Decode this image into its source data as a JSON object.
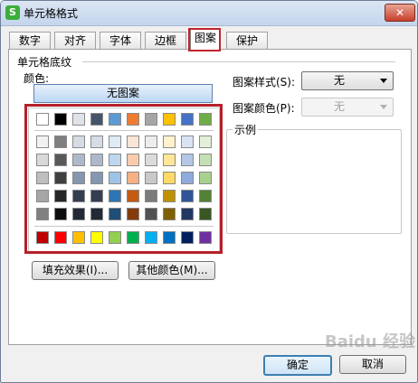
{
  "window": {
    "title": "单元格格式",
    "close_label": "✕",
    "app_icon_text": "S"
  },
  "tabs": [
    {
      "label": "数字"
    },
    {
      "label": "对齐"
    },
    {
      "label": "字体"
    },
    {
      "label": "边框"
    },
    {
      "label": "图案"
    },
    {
      "label": "保护"
    }
  ],
  "active_tab": "图案",
  "group": {
    "title": "单元格底纹",
    "color_label": "颜色:",
    "no_pattern_button": "无图案"
  },
  "pattern_style": {
    "label": "图案样式(S):",
    "value": "无"
  },
  "pattern_color": {
    "label": "图案颜色(P):",
    "value": "无",
    "disabled": true
  },
  "preview": {
    "title": "示例"
  },
  "buttons": {
    "fill_effects": "填充效果(I)...",
    "more_colors": "其他颜色(M)...",
    "ok": "确定",
    "cancel": "取消"
  },
  "palette": {
    "top_row": [
      "#ffffff",
      "#000000",
      "#dfe3e8",
      "#44546a",
      "#5b9bd5",
      "#ed7d31",
      "#a5a5a5",
      "#ffc000",
      "#4472c4",
      "#70ad47"
    ],
    "tint_rows": [
      [
        "#f2f2f2",
        "#7f7f7f",
        "#d6dce4",
        "#d6dce5",
        "#deebf7",
        "#fbe5d6",
        "#ededed",
        "#fff2cc",
        "#dae3f3",
        "#e2f0d9"
      ],
      [
        "#d9d9d9",
        "#595959",
        "#adb9ca",
        "#adb9ca",
        "#bdd7ee",
        "#f8cbad",
        "#dbdbdb",
        "#ffe699",
        "#b4c7e7",
        "#c5e0b4"
      ],
      [
        "#bfbfbf",
        "#404040",
        "#8497b0",
        "#8497b0",
        "#9dc3e6",
        "#f4b183",
        "#c9c9c9",
        "#ffd966",
        "#8faadc",
        "#a9d18e"
      ],
      [
        "#a6a6a6",
        "#262626",
        "#333f50",
        "#333f50",
        "#2e75b6",
        "#c55a11",
        "#7b7b7b",
        "#bf9000",
        "#2f5597",
        "#538135"
      ],
      [
        "#808080",
        "#0d0d0d",
        "#222a35",
        "#222a35",
        "#1f4e79",
        "#843c0c",
        "#525252",
        "#7f6000",
        "#203864",
        "#385723"
      ]
    ],
    "standard_row": [
      "#c00000",
      "#ff0000",
      "#ffc000",
      "#ffff00",
      "#92d050",
      "#00b050",
      "#00b0f0",
      "#0070c0",
      "#002060",
      "#7030a0"
    ]
  },
  "watermark": "Baidu 经验"
}
